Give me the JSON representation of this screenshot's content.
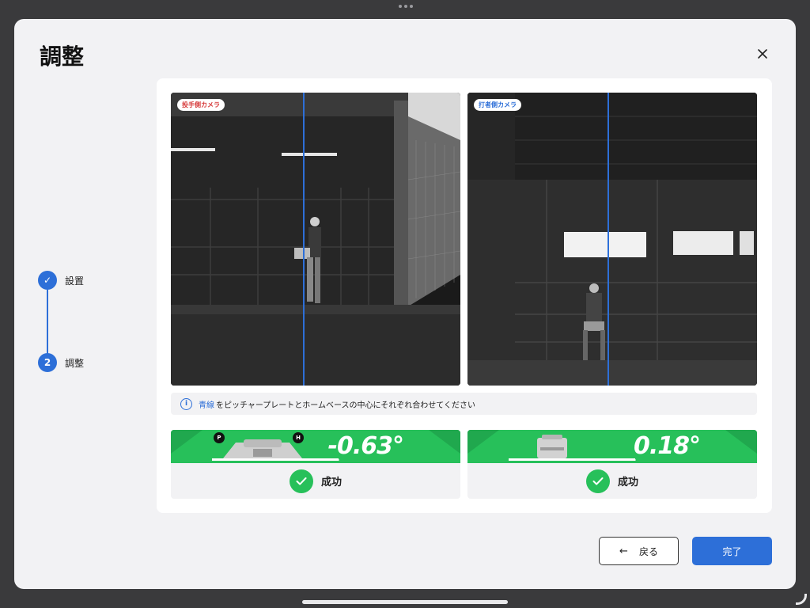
{
  "modal": {
    "title": "調整"
  },
  "stepper": {
    "steps": [
      {
        "number": "✓",
        "label": "設置"
      },
      {
        "number": "2",
        "label": "調整"
      }
    ]
  },
  "cameras": {
    "pitcher": {
      "label": "投手側カメラ"
    },
    "batter": {
      "label": "打者側カメラ"
    }
  },
  "info": {
    "icon": "i",
    "highlight": "青線",
    "text": "をピッチャープレートとホームベースの中心にそれぞれ合わせてください"
  },
  "cards": [
    {
      "value": "-0.63°",
      "status": "成功",
      "markers": [
        "P",
        "H"
      ]
    },
    {
      "value": "0.18°",
      "status": "成功"
    }
  ],
  "buttons": {
    "back": "戻る",
    "done": "完了"
  },
  "colors": {
    "accent": "#2d6fd8",
    "success": "#27c05a",
    "pitcher_badge": "#d63a3a"
  }
}
